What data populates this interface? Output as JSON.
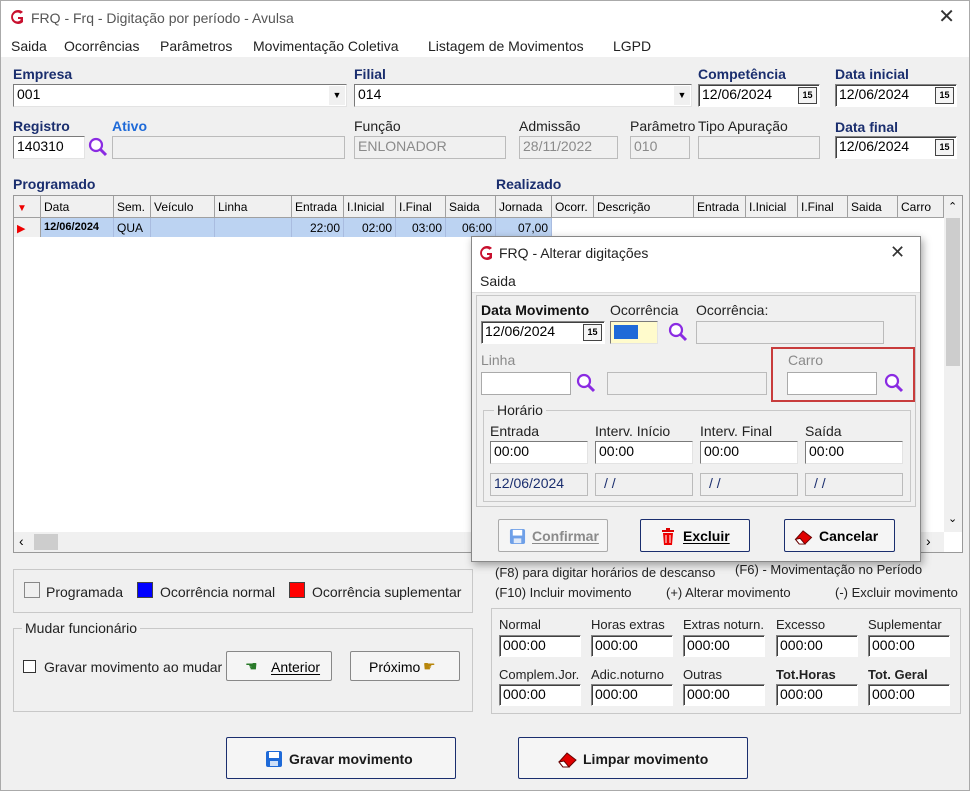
{
  "window": {
    "title": "FRQ - Frq - Digitação por período - Avulsa"
  },
  "menu": [
    "Saida",
    "Ocorrências",
    "Parâmetros",
    "Movimentação Coletiva",
    "Listagem de Movimentos",
    "LGPD"
  ],
  "form": {
    "empresa_label": "Empresa",
    "empresa_value": "001",
    "filial_label": "Filial",
    "filial_value": "014",
    "competencia_label": "Competência",
    "competencia_value": "12/06/2024",
    "data_inicial_label": "Data inicial",
    "data_inicial_value": "12/06/2024",
    "registro_label": "Registro",
    "registro_value": "140310",
    "ativo_label": "Ativo",
    "ativo_value": "",
    "funcao_label": "Função",
    "funcao_value": "ENLONADOR",
    "admissao_label": "Admissão",
    "admissao_value": "28/11/2022",
    "parametro_label": "Parâmetro",
    "parametro_value": "010",
    "tipo_apuracao_label": "Tipo Apuração",
    "tipo_apuracao_value": "",
    "data_final_label": "Data final",
    "data_final_value": "12/06/2024"
  },
  "grid": {
    "programado_label": "Programado",
    "realizado_label": "Realizado",
    "headers": [
      "Data",
      "Sem.",
      "Veículo",
      "Linha",
      "Entrada",
      "I.Inicial",
      "I.Final",
      "Saida",
      "Jornada",
      "Ocorr.",
      "Descrição",
      "Entrada",
      "I.Inicial",
      "I.Final",
      "Saida",
      "Carro"
    ],
    "row": [
      "12/06/2024",
      "QUA",
      "",
      "",
      "22:00",
      "02:00",
      "03:00",
      "06:00",
      "07,00"
    ]
  },
  "legend": {
    "programada": "Programada",
    "ocorrencia_normal": "Ocorrência normal",
    "ocorrencia_suplementar": "Ocorrência suplementar",
    "color_normal": "#0000ff",
    "color_suplementar": "#ff0000"
  },
  "mudar": {
    "title": "Mudar funcionário",
    "gravar_label": "Gravar movimento ao mudar",
    "anterior": "Anterior",
    "proximo": "Próximo"
  },
  "hints": {
    "f8": "(F8) para digitar horários de descanso",
    "f6": "(F6) - Movimentação no Período",
    "f10": "(F10) Incluir movimento",
    "plus": "(+) Alterar movimento",
    "minus": "(-) Excluir movimento"
  },
  "totals": {
    "labels1": [
      "Normal",
      "Horas extras",
      "Extras noturn.",
      "Excesso",
      "Suplementar"
    ],
    "values1": [
      "000:00",
      "000:00",
      "000:00",
      "000:00",
      "000:00"
    ],
    "labels2": [
      "Complem.Jor.",
      "Adic.noturno",
      "Outras",
      "Tot.Horas",
      "Tot. Geral"
    ],
    "values2": [
      "000:00",
      "000:00",
      "000:00",
      "000:00",
      "000:00"
    ]
  },
  "buttons": {
    "gravar": "Gravar movimento",
    "limpar": "Limpar movimento"
  },
  "dialog": {
    "title": "FRQ - Alterar digitações",
    "menu": "Saida",
    "data_mov_label": "Data Movimento",
    "data_mov_value": "12/06/2024",
    "ocorrencia_label": "Ocorrência",
    "ocorrencia2_label": "Ocorrência:",
    "linha_label": "Linha",
    "carro_label": "Carro",
    "horario_title": "Horário",
    "entrada_label": "Entrada",
    "interv_inicio_label": "Interv. Início",
    "interv_final_label": "Interv. Final",
    "saida_label": "Saída",
    "entrada_value": "00:00",
    "interv_inicio_value": "00:00",
    "interv_final_value": "00:00",
    "saida_value": "00:00",
    "date1": "12/06/2024",
    "date2": "/ /",
    "date3": "/ /",
    "date4": "/ /",
    "confirmar": "Confirmar",
    "excluir": "Excluir",
    "cancelar": "Cancelar"
  }
}
